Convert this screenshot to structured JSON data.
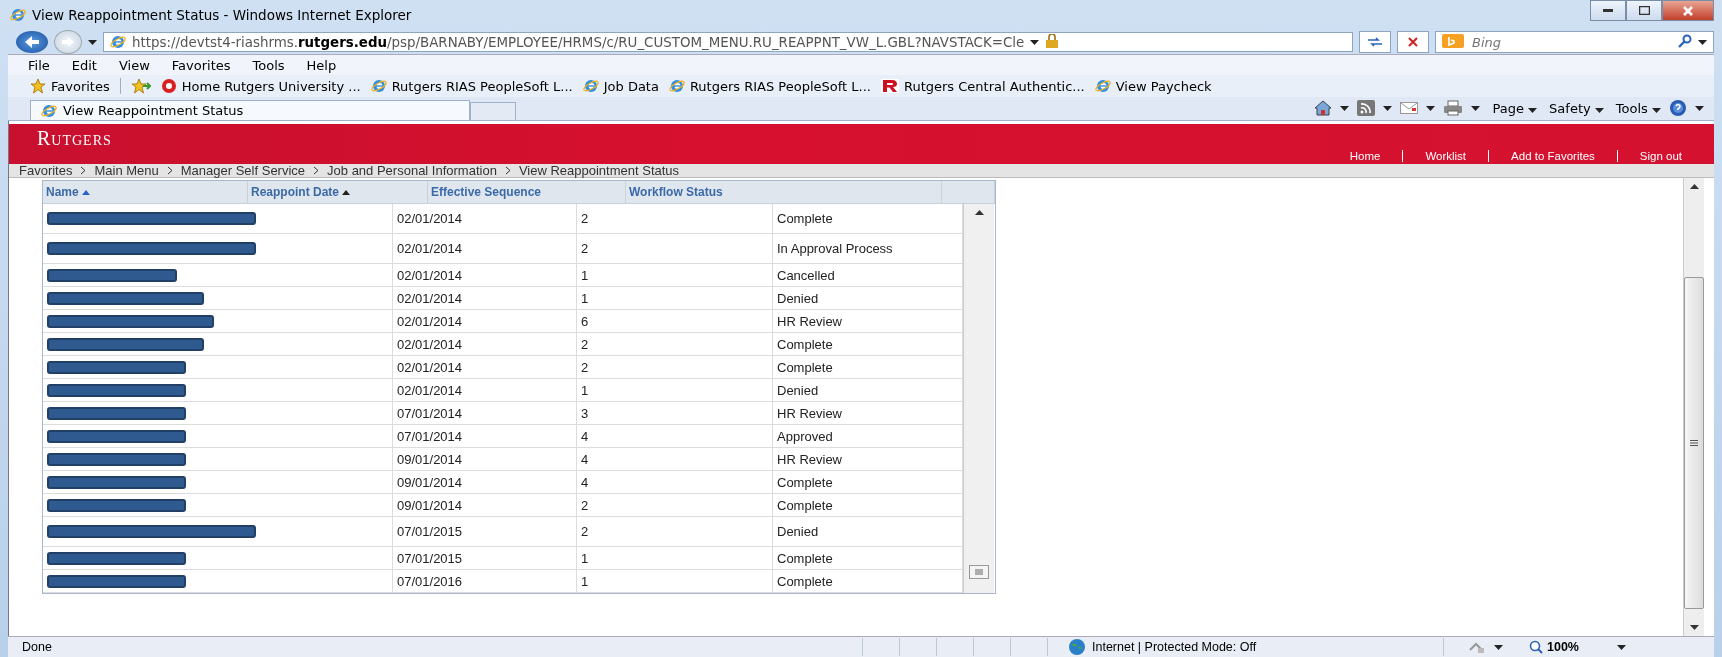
{
  "window": {
    "title": "View Reappointment Status - Windows Internet Explorer"
  },
  "address_bar": {
    "url": "https://devtst4-riashrms.**rutgers.edu**/psp/BARNABY/EMPLOYEE/HRMS/c/RU_CUSTOM_MENU.RU_REAPPNT_VW_L.GBL?NAVSTACK=Cle",
    "search_placeholder": "Bing"
  },
  "menu_bar": [
    "File",
    "Edit",
    "View",
    "Favorites",
    "Tools",
    "Help"
  ],
  "favorites_bar": {
    "label": "Favorites",
    "items": [
      {
        "label": "Home  Rutgers University ...",
        "kind": "site"
      },
      {
        "label": "Rutgers RIAS PeopleSoft L...",
        "kind": "ie"
      },
      {
        "label": "Job Data",
        "kind": "ie"
      },
      {
        "label": "Rutgers RIAS PeopleSoft L...",
        "kind": "ie"
      },
      {
        "label": "Rutgers Central Authentic...",
        "kind": "rutgers"
      },
      {
        "label": "View Paycheck",
        "kind": "ie"
      }
    ]
  },
  "tabs": [
    {
      "label": "View Reappointment Status",
      "selected": true
    }
  ],
  "command_bar": [
    "Page",
    "Safety",
    "Tools"
  ],
  "header": {
    "logo": "Rutgers",
    "links": [
      "Home",
      "Worklist",
      "Add to Favorites",
      "Sign out"
    ]
  },
  "breadcrumb": [
    "Favorites",
    "Main Menu",
    "Manager Self Service",
    "Job and Personal Information",
    "View Reappointment Status"
  ],
  "grid": {
    "columns": [
      {
        "label": "Name",
        "sorted": true
      },
      {
        "label": "Reappoint Date",
        "sorted": true
      },
      {
        "label": "Effective Sequence",
        "sorted": false
      },
      {
        "label": "Workflow Status",
        "sorted": false
      }
    ],
    "rows": [
      {
        "date": "02/01/2014",
        "sequence": "2",
        "status": "Complete",
        "tall": true
      },
      {
        "date": "02/01/2014",
        "sequence": "2",
        "status": "In Approval Process",
        "tall": true
      },
      {
        "date": "02/01/2014",
        "sequence": "1",
        "status": "Cancelled",
        "tall": false
      },
      {
        "date": "02/01/2014",
        "sequence": "1",
        "status": "Denied",
        "tall": false
      },
      {
        "date": "02/01/2014",
        "sequence": "6",
        "status": "HR Review",
        "tall": false
      },
      {
        "date": "02/01/2014",
        "sequence": "2",
        "status": "Complete",
        "tall": false
      },
      {
        "date": "02/01/2014",
        "sequence": "2",
        "status": "Complete",
        "tall": false
      },
      {
        "date": "02/01/2014",
        "sequence": "1",
        "status": "Denied",
        "tall": false
      },
      {
        "date": "07/01/2014",
        "sequence": "3",
        "status": "HR Review",
        "tall": false
      },
      {
        "date": "07/01/2014",
        "sequence": "4",
        "status": "Approved",
        "tall": false
      },
      {
        "date": "09/01/2014",
        "sequence": "4",
        "status": "HR Review",
        "tall": false
      },
      {
        "date": "09/01/2014",
        "sequence": "4",
        "status": "Complete",
        "tall": false
      },
      {
        "date": "09/01/2014",
        "sequence": "2",
        "status": "Complete",
        "tall": false
      },
      {
        "date": "07/01/2015",
        "sequence": "2",
        "status": "Denied",
        "tall": true
      },
      {
        "date": "07/01/2015",
        "sequence": "1",
        "status": "Complete",
        "tall": false
      },
      {
        "date": "07/01/2016",
        "sequence": "1",
        "status": "Complete",
        "tall": false
      }
    ]
  },
  "status_bar": {
    "text": "Done",
    "zone": "Internet | Protected Mode: Off",
    "zoom": "100%"
  }
}
